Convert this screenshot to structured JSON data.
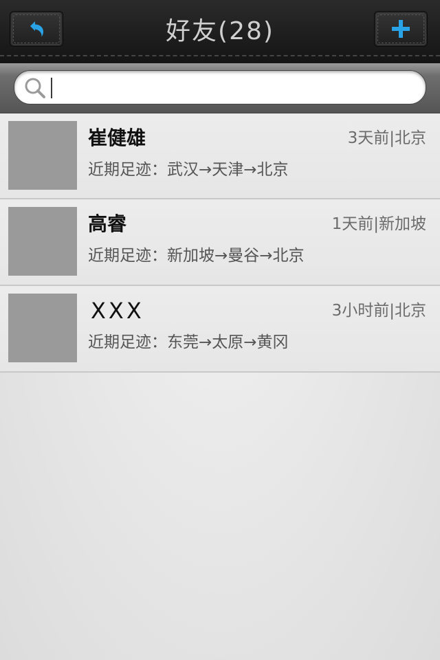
{
  "header": {
    "title": "好友(28)",
    "back_icon": "back-arrow-icon",
    "add_icon": "plus-icon",
    "accent_color": "#2aa3e6"
  },
  "search": {
    "placeholder": "",
    "value": "",
    "icon": "search-icon"
  },
  "friends": [
    {
      "name": "崔健雄",
      "meta": "3天前|北京",
      "trail": "近期足迹：武汉→天津→北京"
    },
    {
      "name": "高睿",
      "meta": "1天前|新加坡",
      "trail": "近期足迹：新加坡→曼谷→北京"
    },
    {
      "name": "XXX",
      "meta": "3小时前|北京",
      "trail": "近期足迹：东莞→太原→黄冈"
    }
  ]
}
